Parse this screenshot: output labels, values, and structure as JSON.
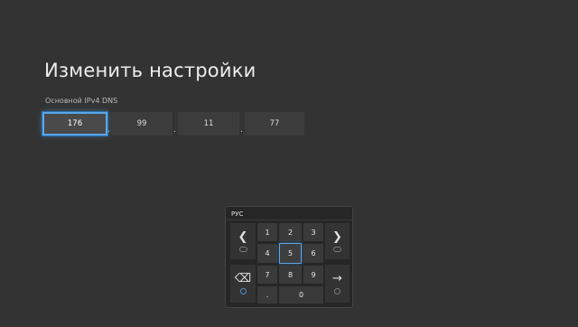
{
  "header": {
    "title": "Изменить настройки"
  },
  "dns": {
    "label": "Основной IPv4 DNS",
    "octets": [
      "176",
      "99",
      "11",
      "77"
    ],
    "separator": "."
  },
  "keypad": {
    "layout_label": "РУС",
    "keys": {
      "k1": "1",
      "k2": "2",
      "k3": "3",
      "k4": "4",
      "k5": "5",
      "k6": "6",
      "k7": "7",
      "k8": "8",
      "k9": "9",
      "dot": ".",
      "k0": "0"
    },
    "focused_key": "5",
    "icons": {
      "left": "chevron-left-icon",
      "right": "chevron-right-icon",
      "backspace": "backspace-icon",
      "enter": "arrow-right-icon"
    }
  },
  "colors": {
    "background": "#333333",
    "focus_accent": "#5aa6e8",
    "keypad_background": "#262626"
  }
}
